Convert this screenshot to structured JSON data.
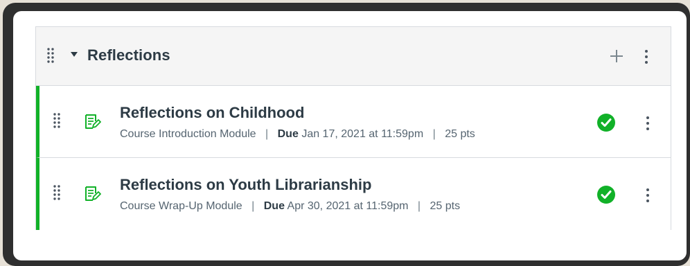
{
  "module": {
    "title": "Reflections",
    "add_icon": "plus-icon",
    "menu_icon": "kebab-icon",
    "collapse_icon": "triangle-down-icon",
    "drag_icon": "drag-handle-icon"
  },
  "items": [
    {
      "title": "Reflections on Childhood",
      "module_name": "Course Introduction Module",
      "due_label": "Due",
      "due_date": "Jan 17, 2021 at 11:59pm",
      "points": "25 pts",
      "separator": "|",
      "type_icon": "assignment-icon",
      "status_icon": "published-check-icon",
      "status_color": "#11b128"
    },
    {
      "title": "Reflections on Youth Librarianship",
      "module_name": "Course Wrap-Up Module",
      "due_label": "Due",
      "due_date": "Apr 30, 2021 at 11:59pm",
      "points": "25 pts",
      "separator": "|",
      "type_icon": "assignment-icon",
      "status_icon": "published-check-icon",
      "status_color": "#11b128"
    }
  ],
  "colors": {
    "accent": "#11b128",
    "text": "#2d3b45",
    "muted": "#556470",
    "header_bg": "#f5f5f5",
    "border": "#d7dadf"
  }
}
